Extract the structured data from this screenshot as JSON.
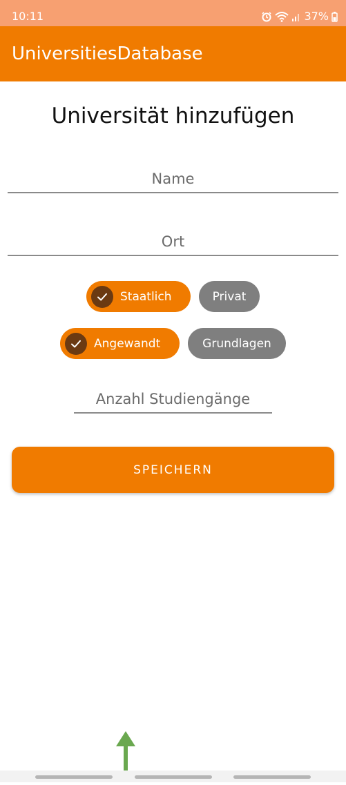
{
  "status_bar": {
    "time": "10:11",
    "battery": "37%",
    "icons": [
      "alarm-icon",
      "wifi-icon",
      "signal-icon",
      "battery-icon"
    ]
  },
  "app_bar": {
    "title": "UniversitiesDatabase"
  },
  "form": {
    "title": "Universität hinzufügen",
    "name_placeholder": "Name",
    "ort_placeholder": "Ort",
    "count_placeholder": "Anzahl Studiengänge",
    "chips_type": [
      {
        "label": "Staatlich",
        "selected": true
      },
      {
        "label": "Privat",
        "selected": false
      }
    ],
    "chips_focus": [
      {
        "label": "Angewandt",
        "selected": true
      },
      {
        "label": "Grundlagen",
        "selected": false
      }
    ],
    "save_label": "SPEICHERN"
  },
  "colors": {
    "primary": "#f07b00",
    "status_bar": "#f7a071",
    "chip_unselected": "#7f7f7f",
    "check_circle": "#6b3a12",
    "gesture_arrow": "#6aa84f"
  }
}
